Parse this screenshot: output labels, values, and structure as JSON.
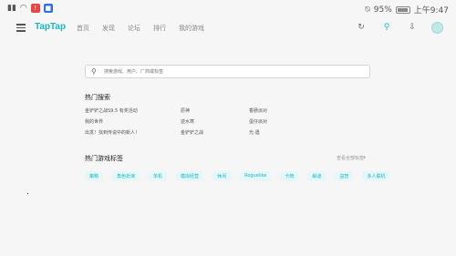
{
  "status_bar": {
    "battery_percent": "95%",
    "time": "上午9:47"
  },
  "nav": {
    "logo": "TapTap",
    "links": [
      "首页",
      "发现",
      "论坛",
      "排行",
      "我的游戏"
    ]
  },
  "search": {
    "placeholder": "搜索游戏、用户、厂商或标签"
  },
  "hot_search": {
    "title": "热门搜索",
    "rows": [
      [
        "金铲铲之战S9.5 有奖活动",
        "原神",
        "香肠派对"
      ],
      [
        "我的世界",
        "逆水寒",
        "蛋仔派对"
      ],
      [
        "出发！找到传说中的新人！",
        "金铲铲之战",
        "光·遇"
      ]
    ]
  },
  "hot_tags": {
    "title": "热门游戏标签",
    "more": "查看全部标签",
    "tags": [
      "策略",
      "角色扮演",
      "单机",
      "模拟经营",
      "休闲",
      "Roguelike",
      "卡牌",
      "解谜",
      "益智",
      "多人联机"
    ]
  }
}
